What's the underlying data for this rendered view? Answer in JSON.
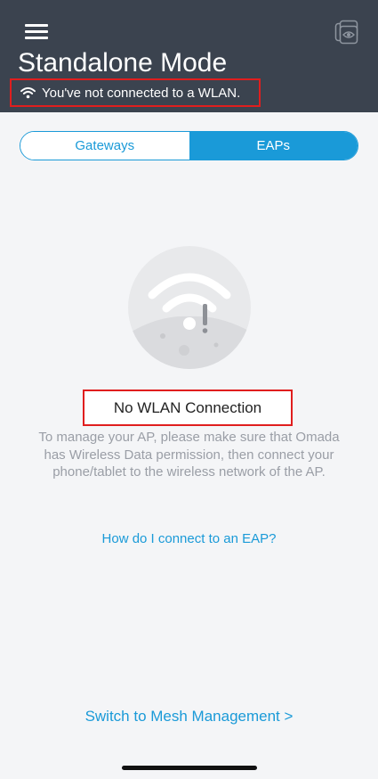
{
  "header": {
    "title": "Standalone Mode",
    "wlan_status": "You've not connected to a WLAN.",
    "background_color": "#3b434f",
    "menu_icon": "hamburger-menu-icon",
    "view_icon": "device-view-icon"
  },
  "tabs": {
    "gateways_label": "Gateways",
    "eaps_label": "EAPs",
    "selected": "EAPs",
    "accent_color": "#1a9ad8"
  },
  "main": {
    "illustration_icon": "wifi-warning-icon",
    "empty_title": "No WLAN Connection",
    "empty_description": "To manage your AP, please make sure that Omada has Wireless Data permission, then connect your phone/tablet to the wireless network of the AP.",
    "help_link": "How do I connect to an EAP?"
  },
  "footer": {
    "mesh_link": "Switch to Mesh Management >"
  },
  "highlight_color": "#e01e1e"
}
